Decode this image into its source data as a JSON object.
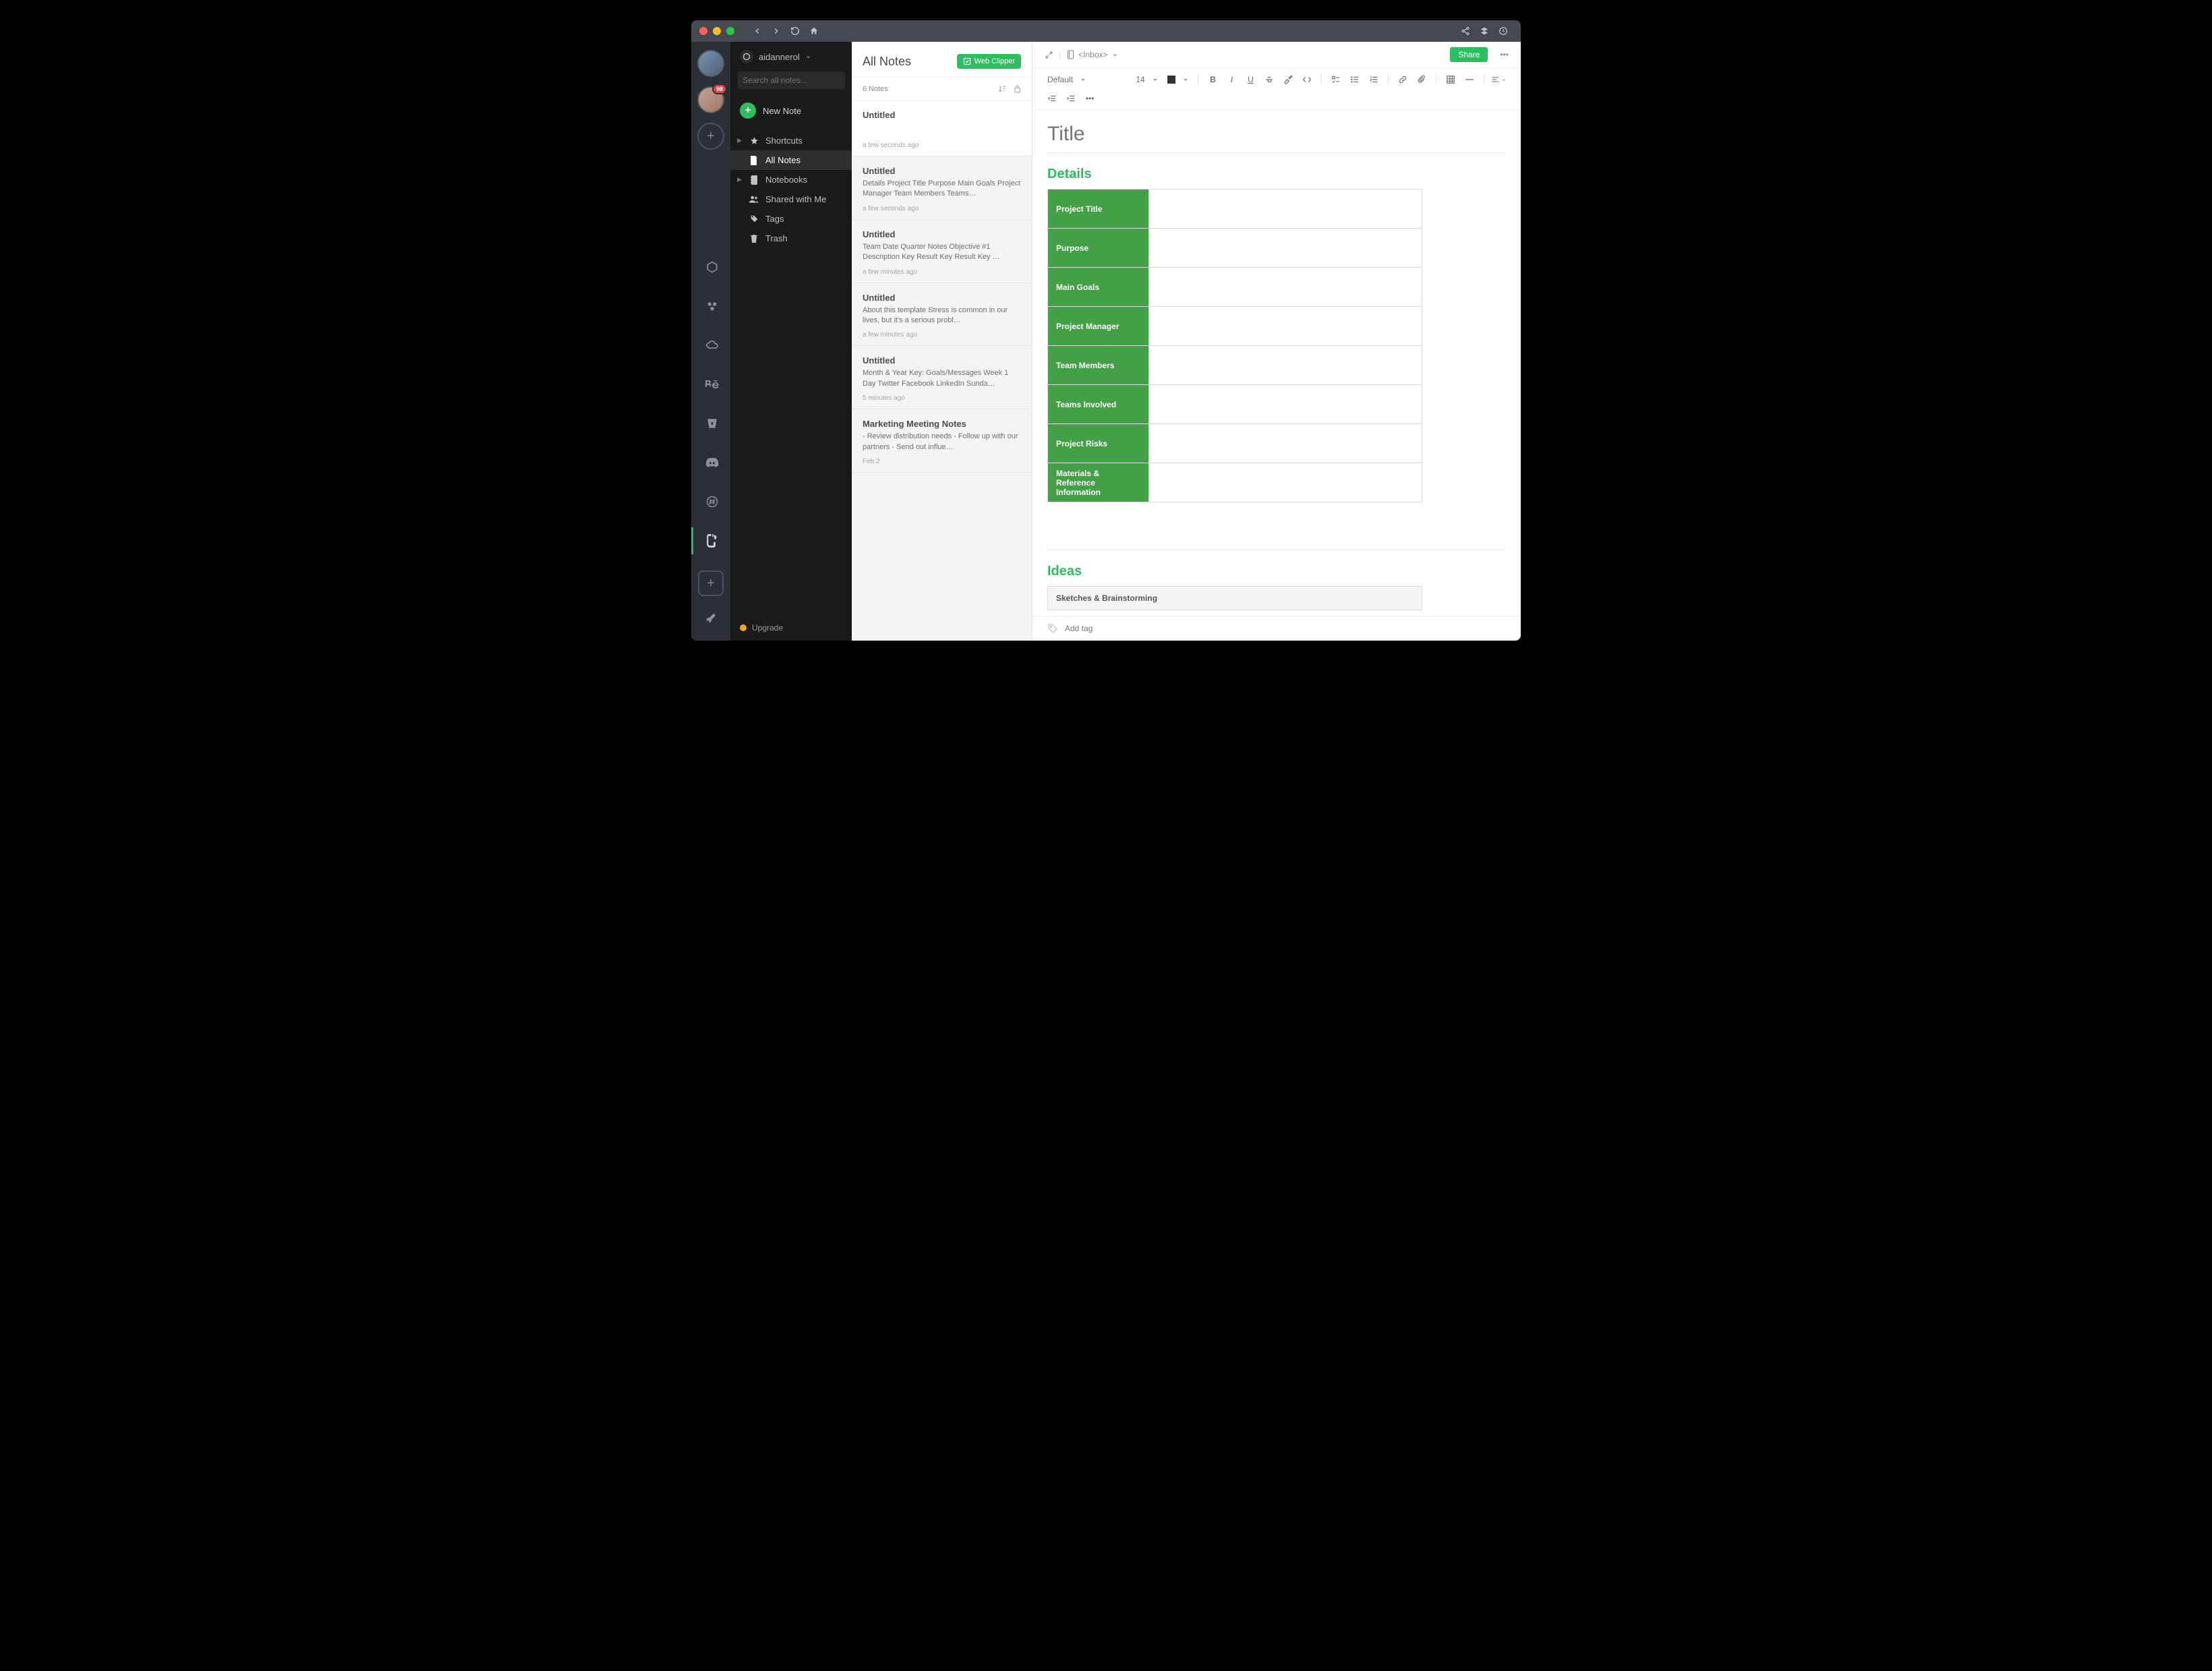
{
  "launcher": {
    "badge": "98"
  },
  "account": {
    "name": "aidannerol"
  },
  "search": {
    "placeholder": "Search all notes..."
  },
  "newnote": {
    "label": "New Note"
  },
  "nav": {
    "shortcuts": "Shortcuts",
    "allnotes": "All Notes",
    "notebooks": "Notebooks",
    "shared": "Shared with Me",
    "tags": "Tags",
    "trash": "Trash"
  },
  "upgrade": {
    "label": "Upgrade"
  },
  "noteslist": {
    "heading": "All Notes",
    "clipper": "Web Clipper",
    "count": "6 Notes",
    "items": [
      {
        "title": "Untitled",
        "preview": "",
        "date": "a few seconds ago"
      },
      {
        "title": "Untitled",
        "preview": "Details Project Title Purpose Main Goals Project Manager Team Members Teams…",
        "date": "a few seconds ago"
      },
      {
        "title": "Untitled",
        "preview": "Team Date Quarter Notes Objective #1 Description Key Result Key Result Key …",
        "date": "a few minutes ago"
      },
      {
        "title": "Untitled",
        "preview": "About this template Stress is common in our lives, but it's a serious probl…",
        "date": "a few minutes ago"
      },
      {
        "title": "Untitled",
        "preview": "Month & Year Key: Goals/Messages Week 1 Day Twitter Facebook LinkedIn Sunda…",
        "date": "5 minutes ago"
      },
      {
        "title": "Marketing Meeting Notes",
        "preview": "- Review distribution needs - Follow up with our partners - Send out influe…",
        "date": "Feb 2"
      }
    ]
  },
  "editor": {
    "breadcrumb_notebook": "Inbox",
    "share": "Share",
    "font_family": "Default",
    "font_size": "14",
    "title_placeholder": "Title",
    "sections": {
      "details": "Details",
      "ideas": "Ideas"
    },
    "details_rows": [
      "Project Title",
      "Purpose",
      "Main Goals",
      "Project Manager",
      "Team Members",
      "Teams Involved",
      "Project Risks",
      "Materials & Reference Information"
    ],
    "ideas_row": "Sketches & Brainstorming",
    "addtag_placeholder": "Add tag"
  }
}
